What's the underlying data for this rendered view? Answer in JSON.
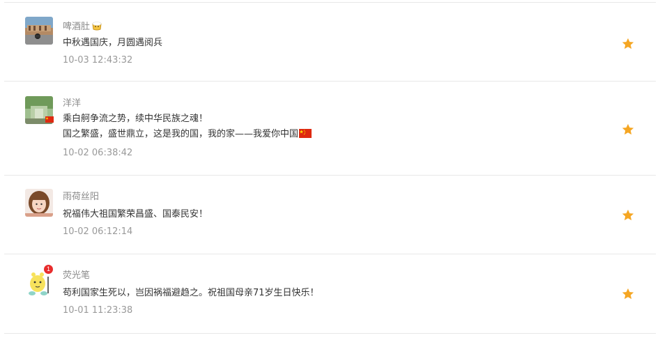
{
  "comments": [
    {
      "user": "啤酒肚",
      "icon": "beer-emoji-icon",
      "lines": [
        "中秋遇国庆，月圆遇阅兵"
      ],
      "time": "10-03 12:43:32"
    },
    {
      "user": "洋洋",
      "icon": "china-flag-icon",
      "lines": [
        "乘白舸争流之势，续中华民族之魂！",
        "国之繁盛，盛世鼎立，这是我的国，我的家——我爱你中国"
      ],
      "time": "10-02 06:38:42"
    },
    {
      "user": "雨荷丝阳",
      "lines": [
        "祝福伟大祖国繁荣昌盛、国泰民安！"
      ],
      "time": "10-02 06:12:14"
    },
    {
      "user": "荧光笔",
      "badge": "1",
      "lines": [
        "苟利国家生死以，岂因祸福避趋之。祝祖国母亲71岁生日快乐！"
      ],
      "time": "10-01 11:23:38"
    }
  ],
  "colors": {
    "star": "#f5a623",
    "divider": "#e8e8e8",
    "username": "#8a8a8a",
    "timestamp": "#999999"
  }
}
